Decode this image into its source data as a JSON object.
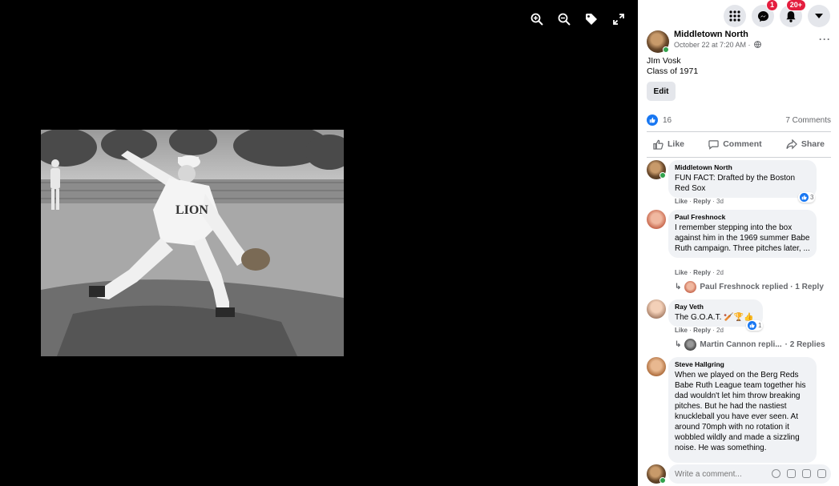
{
  "viewer": {
    "tools": [
      {
        "name": "zoom-in-icon"
      },
      {
        "name": "zoom-out-icon"
      },
      {
        "name": "tag-icon"
      },
      {
        "name": "fullscreen-icon"
      }
    ],
    "photo_alt": "Black and white photo of a baseball pitcher mid-throw"
  },
  "topbar": {
    "messenger_badge": "1",
    "notifications_badge": "20+"
  },
  "post": {
    "page_name": "Middletown North",
    "date": "October 22 at 7:20 AM ·",
    "caption_line1": "JIm Vosk",
    "caption_line2": "Class of 1971",
    "edit_label": "Edit",
    "like_count": "16",
    "comment_count": "7 Comments",
    "actions": {
      "like": "Like",
      "comment": "Comment",
      "share": "Share"
    }
  },
  "comments": [
    {
      "name": "Middletown North",
      "text": "FUN FACT: Drafted by the Boston Red Sox",
      "like": "Like",
      "reply": "Reply",
      "time": "3d",
      "reactions": "3"
    },
    {
      "name": "Paul Freshnock",
      "text": "I remember stepping into the box against him in the 1969 summer Babe Ruth campaign. Three pitches later, ...",
      "like": "Like",
      "reply": "Reply",
      "time": "2d",
      "replies": "Paul Freshnock replied · 1 Reply"
    },
    {
      "name": "Ray Veth",
      "text": "The G.O.A.T. 🏏🏆👍",
      "like": "Like",
      "reply": "Reply",
      "time": "2d",
      "reactions": "1",
      "replies_name": "Martin Cannon repli...",
      "replies_count": "· 2 Replies"
    },
    {
      "name": "Steve Hallgring",
      "text": "When we played on the Berg Reds Babe Ruth League team together his dad wouldn't let him throw breaking pitches. But he had the nastiest knuckleball you have ever seen. At around 70mph with no rotation it wobbled wildly and made a sizzling noise. He was something."
    }
  ],
  "compose": {
    "placeholder": "Write a comment..."
  },
  "colors": {
    "accent": "#1877f2",
    "badge": "#e41e3f",
    "bubble": "#f0f2f5"
  }
}
